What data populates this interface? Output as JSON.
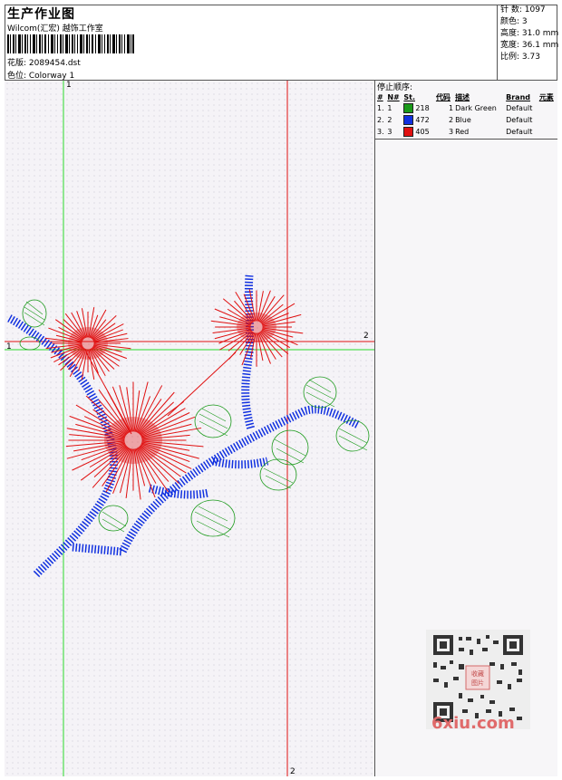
{
  "header": {
    "title": "生产作业图",
    "company": "Wilcom(汇宏) 越饰工作室",
    "design": "花版: 2089454.dst",
    "colorway": "色位: Colorway 1"
  },
  "stats": {
    "stitches": "针 数: 1097",
    "colors": "颜色: 3",
    "height": "高度: 31.0 mm",
    "width": "宽度: 36.1 mm",
    "scale": "比例: 3.73"
  },
  "stop_sequence": {
    "title": "停止顺序:",
    "headers": [
      "#",
      "N#",
      "St.",
      "代码",
      "描述",
      "Brand",
      "元素"
    ],
    "rows": [
      {
        "num": "1.",
        "n": "1",
        "color": "#1a9a1a",
        "st": "218",
        "code": "1",
        "desc": "Dark Green",
        "brand": "Default"
      },
      {
        "num": "2.",
        "n": "2",
        "color": "#1030e0",
        "st": "472",
        "code": "2",
        "desc": "Blue",
        "brand": "Default"
      },
      {
        "num": "3.",
        "n": "3",
        "color": "#e01010",
        "st": "405",
        "code": "3",
        "desc": "Red",
        "brand": "Default"
      }
    ]
  },
  "guides": {
    "label_1": "1",
    "label_2": "2"
  },
  "watermark": {
    "text": "6xiu.com",
    "badge": "收藏图片"
  },
  "colors": {
    "green": "#1a9a1a",
    "blue": "#1030e0",
    "red": "#e01010"
  }
}
